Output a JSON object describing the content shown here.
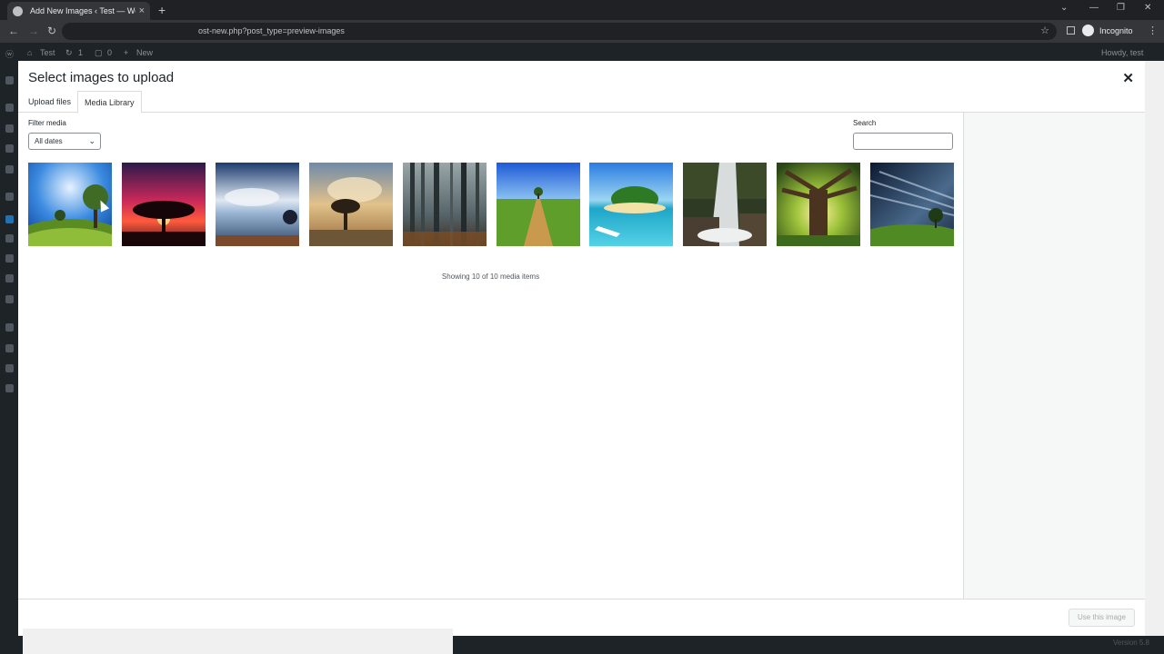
{
  "browser": {
    "tab_title": "Add New Images ‹ Test — WordP",
    "url": "ost-new.php?post_type=preview-images",
    "incognito_label": "Incognito"
  },
  "adminbar": {
    "site_name": "Test",
    "updates_count": "1",
    "comments_count": "0",
    "new_label": "New",
    "howdy": "Howdy, test"
  },
  "modal": {
    "title": "Select images to upload",
    "close_icon": "close-icon",
    "tabs": [
      {
        "label": "Upload files",
        "active": false
      },
      {
        "label": "Media Library",
        "active": true
      }
    ],
    "filter_label": "Filter media",
    "filter_value": "All dates",
    "search_label": "Search",
    "search_value": "",
    "media_count": "Showing 10 of 10 media items",
    "use_button": "Use this image",
    "items": [
      {
        "name": "tree-blue-sky"
      },
      {
        "name": "tree-red-sunset"
      },
      {
        "name": "clouds-reflection"
      },
      {
        "name": "tree-golden-clouds"
      },
      {
        "name": "misty-forest"
      },
      {
        "name": "road-to-tree"
      },
      {
        "name": "tropical-island"
      },
      {
        "name": "waterfall"
      },
      {
        "name": "big-tree-sunlight"
      },
      {
        "name": "night-sky-tree"
      }
    ]
  },
  "footer": {
    "version": "Version 5.8"
  }
}
